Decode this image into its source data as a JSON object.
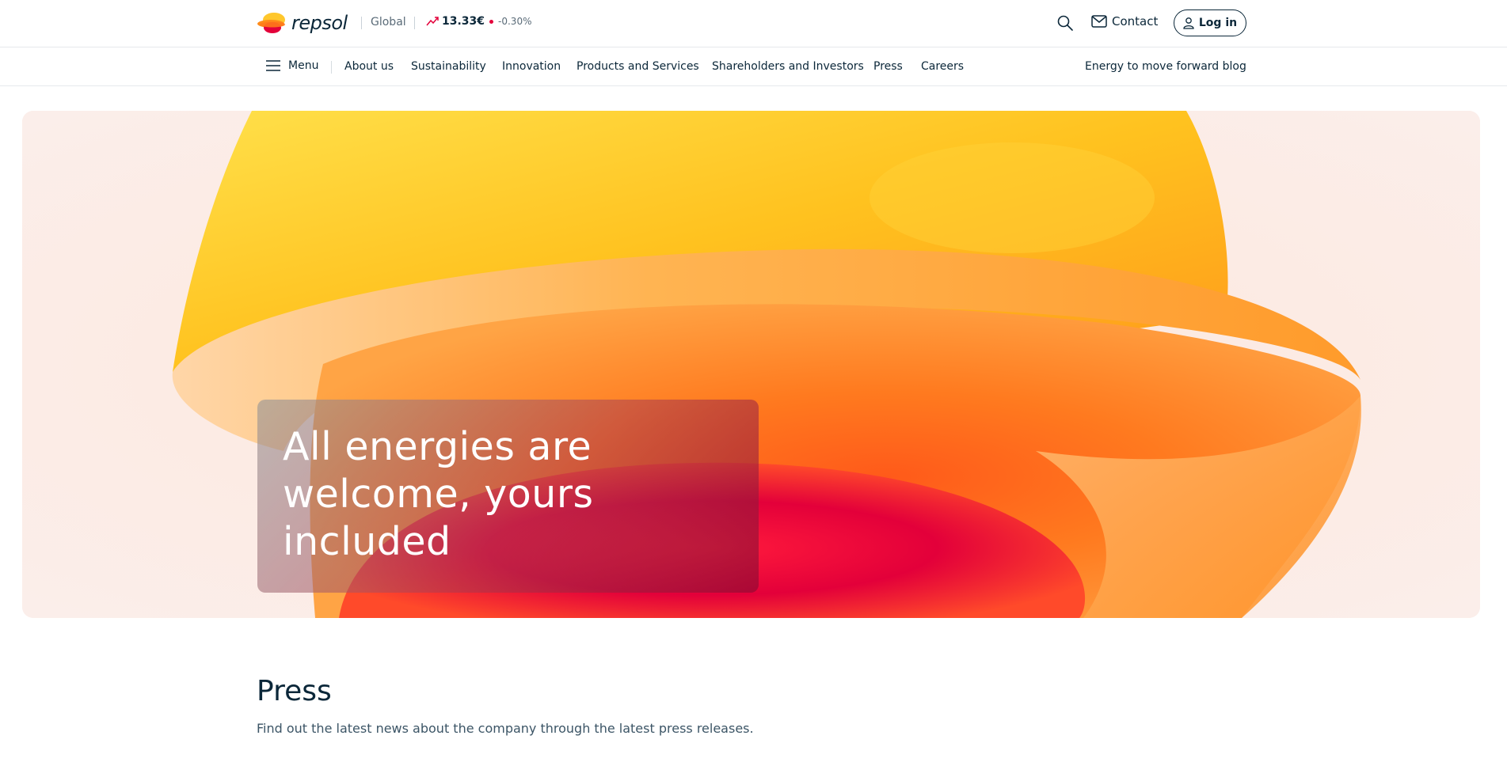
{
  "header": {
    "brand": "repsol",
    "region": "Global",
    "stock_price": "13.33€",
    "stock_change": "-0.30%",
    "contact_label": "Contact",
    "login_label": "Log in",
    "icons": {
      "logo": "repsol-logo-icon",
      "trend": "trend-up-icon",
      "search": "search-icon",
      "contact": "mail-icon",
      "login": "user-icon"
    }
  },
  "nav": {
    "menu_label": "Menu",
    "items": [
      {
        "label": "About us"
      },
      {
        "label": "Sustainability"
      },
      {
        "label": "Innovation"
      },
      {
        "label": "Products and Services"
      },
      {
        "label": "Shareholders and Investors"
      },
      {
        "label": "Press"
      },
      {
        "label": "Careers"
      }
    ],
    "blog_label": "Energy to move forward blog"
  },
  "hero": {
    "title": "All energies are welcome, yours included"
  },
  "press": {
    "title": "Press",
    "description": "Find out the latest news about the company through the latest press releases."
  },
  "colors": {
    "text_primary": "#0b2739",
    "stock_dot": "#e3003a",
    "hero_bg": "#fbeeea",
    "accent_orange": "#ff7a1a",
    "accent_red": "#e3003a"
  }
}
